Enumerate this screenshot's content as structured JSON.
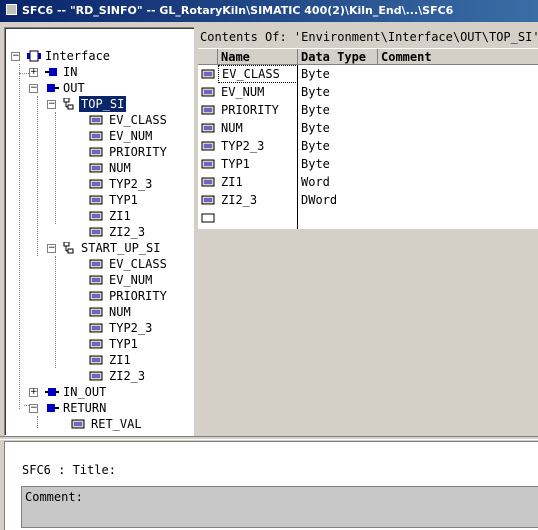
{
  "window": {
    "title": "SFC6 -- \"RD_SINFO\" -- GL_RotaryKiln\\SIMATIC 400(2)\\Kiln_End\\...\\SFC6"
  },
  "tree": {
    "items": [
      {
        "label": "Interface",
        "expander": "−"
      },
      {
        "label": "IN",
        "expander": "+"
      },
      {
        "label": "OUT",
        "expander": "−"
      },
      {
        "label": "TOP_SI",
        "expander": "−"
      },
      {
        "label": "EV_CLASS"
      },
      {
        "label": "EV_NUM"
      },
      {
        "label": "PRIORITY"
      },
      {
        "label": "NUM"
      },
      {
        "label": "TYP2_3"
      },
      {
        "label": "TYP1"
      },
      {
        "label": "ZI1"
      },
      {
        "label": "ZI2_3"
      },
      {
        "label": "START_UP_SI",
        "expander": "−"
      },
      {
        "label": "EV_CLASS"
      },
      {
        "label": "EV_NUM"
      },
      {
        "label": "PRIORITY"
      },
      {
        "label": "NUM"
      },
      {
        "label": "TYP2_3"
      },
      {
        "label": "TYP1"
      },
      {
        "label": "ZI1"
      },
      {
        "label": "ZI2_3"
      },
      {
        "label": "IN_OUT",
        "expander": "+"
      },
      {
        "label": "RETURN",
        "expander": "−"
      },
      {
        "label": "RET_VAL"
      }
    ]
  },
  "contents": {
    "header": "Contents Of: 'Environment\\Interface\\OUT\\TOP_SI'",
    "columns": [
      "Name",
      "Data Type",
      "Comment"
    ],
    "rows": [
      {
        "name": "EV_CLASS",
        "type": "Byte",
        "comment": ""
      },
      {
        "name": "EV_NUM",
        "type": "Byte",
        "comment": ""
      },
      {
        "name": "PRIORITY",
        "type": "Byte",
        "comment": ""
      },
      {
        "name": "NUM",
        "type": "Byte",
        "comment": ""
      },
      {
        "name": "TYP2_3",
        "type": "Byte",
        "comment": ""
      },
      {
        "name": "TYP1",
        "type": "Byte",
        "comment": ""
      },
      {
        "name": "ZI1",
        "type": "Word",
        "comment": ""
      },
      {
        "name": "ZI2_3",
        "type": "DWord",
        "comment": ""
      }
    ]
  },
  "bottom": {
    "title_line": "SFC6 : Title:",
    "comment_label": "Comment:"
  },
  "colors": {
    "selection": "#0a246a",
    "titlebar_start": "#0a246a",
    "titlebar_end": "#3a6ea5",
    "icon_blue": "#0000c0"
  }
}
